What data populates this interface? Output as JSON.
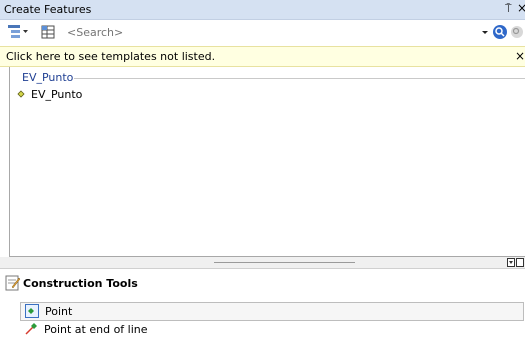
{
  "window": {
    "title": "Create Features",
    "pin_glyph": "⍑",
    "close_glyph": "×"
  },
  "toolbar": {
    "search_placeholder": "<Search>"
  },
  "info_bar": {
    "text": "Click here to see templates not listed.",
    "close_glyph": "×"
  },
  "templates": {
    "groups": [
      {
        "name": "EV_Punto",
        "items": [
          {
            "label": "EV_Punto",
            "icon": "point-symbol-icon"
          }
        ]
      }
    ]
  },
  "construction_tools": {
    "title": "Construction Tools",
    "tools": [
      {
        "label": "Point",
        "icon": "point-tool-icon",
        "selected": true
      },
      {
        "label": "Point at end of line",
        "icon": "point-at-end-of-line-icon",
        "selected": false
      }
    ]
  },
  "colors": {
    "title_bar": "#d5e1f2",
    "info_bar": "#ffffe1",
    "group_header": "#1f3f93",
    "selection_border": "#bdbdbd"
  }
}
